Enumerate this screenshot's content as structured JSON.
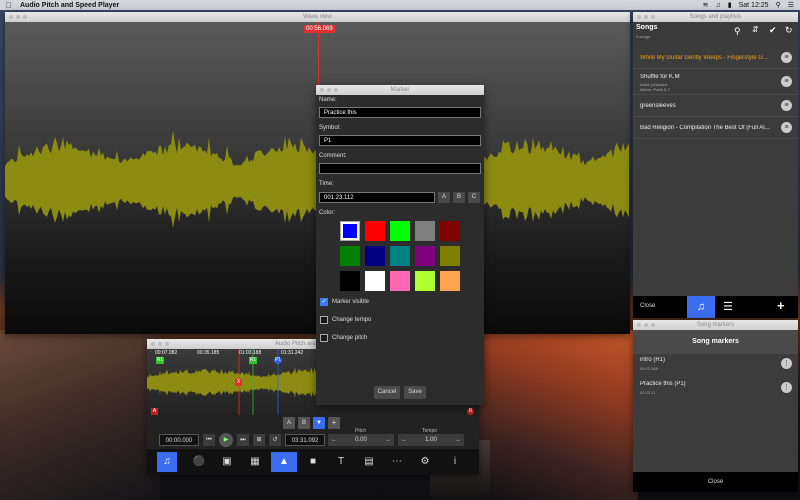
{
  "menubar": {
    "app_name": "Audio Pitch and Speed Player",
    "clock": "Sat 12:25"
  },
  "wave_window": {
    "title": "Wave view",
    "playhead_time": "00:56.069"
  },
  "marker_dialog": {
    "title": "Marker",
    "name_label": "Name:",
    "name_value": "Practice this",
    "symbol_label": "Symbol:",
    "symbol_value": "P1",
    "comment_label": "Comment:",
    "comment_value": "",
    "time_label": "Time:",
    "time_value": "001:23.112",
    "time_buttons": [
      "A",
      "B",
      "C"
    ],
    "color_label": "Color:",
    "colors": [
      "#0000ff",
      "#ff0000",
      "#00ff00",
      "#808080",
      "#800000",
      "#008000",
      "#000080",
      "#008080",
      "#800080",
      "#808000",
      "#000000",
      "#ffffff",
      "#ff69b4",
      "#adff2f",
      "#ffa54f"
    ],
    "selected_color": "#0000ff",
    "marker_visible_label": "Marker visible",
    "change_tempo_label": "Change tempo",
    "change_pitch_label": "Change pitch",
    "cancel_label": "Cancel",
    "save_label": "Save"
  },
  "songs_window": {
    "title": "Songs and playlists",
    "header": "Songs",
    "count": "4 songs",
    "songs": [
      {
        "title": "While My Guitar Gently Weeps - Fingerstyle G...",
        "sub": "",
        "active": true
      },
      {
        "title": "Shuffle for K.M",
        "sub": "Artist: johnhard\nAlbum: Parts 5-7",
        "active": false
      },
      {
        "title": "greensleeves",
        "sub": "",
        "active": false
      },
      {
        "title": "Bad Religion - Compilation The Best Of (Full Al...",
        "sub": "",
        "active": false
      }
    ],
    "close_label": "Close",
    "add_label": "+"
  },
  "markers_window": {
    "title": "Song markers",
    "header": "Song markers",
    "markers": [
      {
        "name": "intro (R1)",
        "time": "00:03.365"
      },
      {
        "name": "Practice this (P1)",
        "time": "01:23.11"
      }
    ],
    "close_label": "Close"
  },
  "mini_player": {
    "title": "Audio Pitch and",
    "marker_times": [
      "00:07.082",
      "00:35.185",
      "01:03.188",
      "01:31.242"
    ],
    "marker_symbols": [
      "R1",
      "X",
      "R1",
      "P1"
    ],
    "edge_labels": [
      "A",
      "B"
    ],
    "ab_buttons": [
      "A",
      "B",
      "+"
    ],
    "current_time": "00:00.000",
    "total_time": "03:31.092",
    "pitch_label": "Pitch",
    "pitch_value": "0.00",
    "tempo_label": "Tempo",
    "tempo_value": "1.00",
    "toolbar_icon_names": [
      "music-icon",
      "microphone-icon",
      "save-icon",
      "export-icon",
      "waveform-icon",
      "video-icon",
      "text-icon",
      "image-icon",
      "more-icon",
      "settings-icon",
      "info-icon"
    ]
  }
}
